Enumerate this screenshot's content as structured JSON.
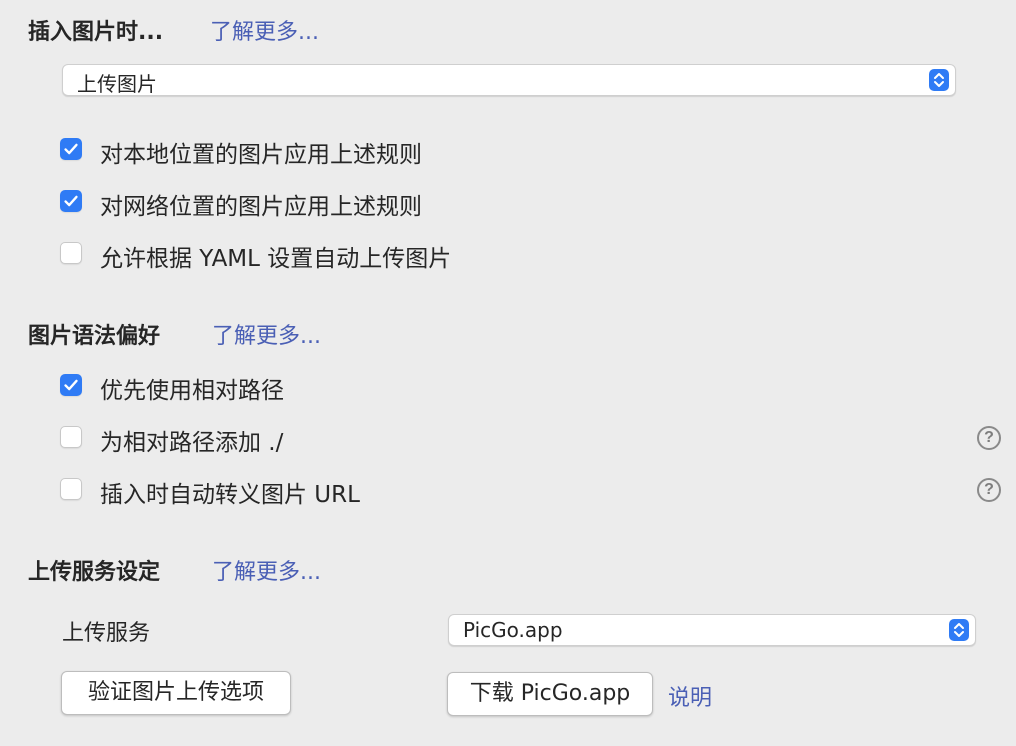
{
  "insert_section": {
    "title": "插入图片时...",
    "learn_more": "了解更多...",
    "action_select": "上传图片",
    "options": [
      {
        "label": "对本地位置的图片应用上述规则",
        "checked": true
      },
      {
        "label": "对网络位置的图片应用上述规则",
        "checked": true
      },
      {
        "label": "允许根据 YAML 设置自动上传图片",
        "checked": false
      }
    ]
  },
  "syntax_section": {
    "title": "图片语法偏好",
    "learn_more": "了解更多...",
    "options": [
      {
        "label": "优先使用相对路径",
        "checked": true,
        "help": false
      },
      {
        "label": "为相对路径添加 ./",
        "checked": false,
        "help": true
      },
      {
        "label": "插入时自动转义图片 URL",
        "checked": false,
        "help": true
      }
    ]
  },
  "upload_section": {
    "title": "上传服务设定",
    "learn_more": "了解更多...",
    "service_label": "上传服务",
    "service_select": "PicGo.app",
    "validate_button": "验证图片上传选项",
    "download_button": "下载 PicGo.app",
    "help_link": "说明"
  },
  "icons": {
    "help": "?",
    "stepper": "chevron-up-down-icon",
    "checkmark": "checkmark-icon"
  },
  "colors": {
    "accent": "#2f7bf5",
    "link": "#4a5fb5",
    "background": "#ececec"
  }
}
